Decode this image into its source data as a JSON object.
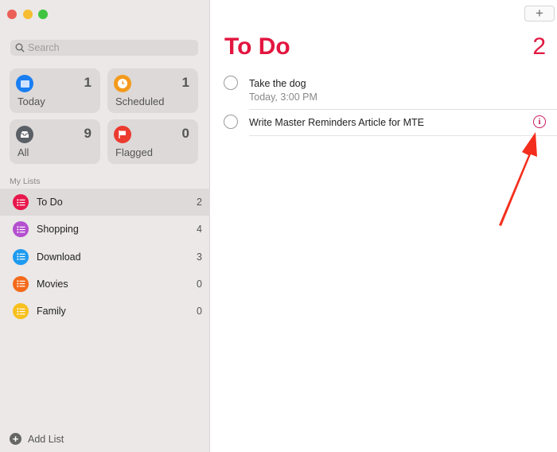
{
  "window": {
    "controls": [
      {
        "name": "close",
        "color": "#ec5f57"
      },
      {
        "name": "minimize",
        "color": "#f5bd2f"
      },
      {
        "name": "zoom",
        "color": "#3fc43f"
      }
    ]
  },
  "sidebar": {
    "search_placeholder": "Search",
    "smart_lists": [
      {
        "label": "Today",
        "count": "1",
        "icon": "calendar-icon",
        "color": "#1a7ef2"
      },
      {
        "label": "Scheduled",
        "count": "1",
        "icon": "clock-icon",
        "color": "#f39a1d"
      },
      {
        "label": "All",
        "count": "9",
        "icon": "tray-icon",
        "color": "#5b5f66"
      },
      {
        "label": "Flagged",
        "count": "0",
        "icon": "flag-icon",
        "color": "#ec3b2f"
      }
    ],
    "section_title": "My Lists",
    "lists": [
      {
        "label": "To Do",
        "count": "2",
        "color": "#e8174b",
        "selected": true
      },
      {
        "label": "Shopping",
        "count": "4",
        "color": "#b44fd0"
      },
      {
        "label": "Download",
        "count": "3",
        "color": "#1e9bf0"
      },
      {
        "label": "Movies",
        "count": "0",
        "color": "#f46a1a"
      },
      {
        "label": "Family",
        "count": "0",
        "color": "#f7c01d"
      }
    ],
    "add_list_label": "Add List"
  },
  "main": {
    "add_button": "+",
    "title": "To Do",
    "count": "2",
    "accent": "#e2163f",
    "tasks": [
      {
        "title": "Take the dog",
        "subtitle": "Today, 3:00 PM"
      },
      {
        "title": "Write Master Reminders Article for MTE",
        "info_icon": "i"
      }
    ],
    "annotation": {
      "type": "arrow",
      "color": "#f42e1c",
      "points_to": "info-button"
    }
  }
}
